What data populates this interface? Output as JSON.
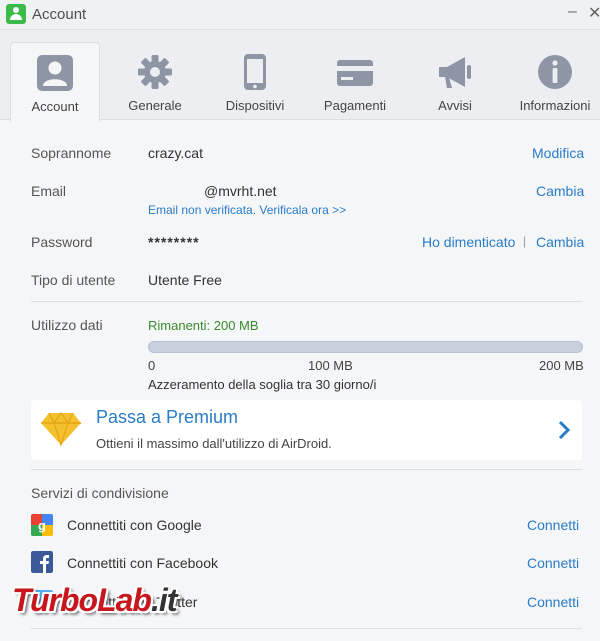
{
  "window": {
    "title": "Account"
  },
  "tabs": [
    {
      "label": "Account",
      "icon": "user-icon",
      "active": true
    },
    {
      "label": "Generale",
      "icon": "gear-icon"
    },
    {
      "label": "Dispositivi",
      "icon": "phone-icon"
    },
    {
      "label": "Pagamenti",
      "icon": "credit-card-icon"
    },
    {
      "label": "Avvisi",
      "icon": "megaphone-icon"
    },
    {
      "label": "Informazioni",
      "icon": "info-icon"
    }
  ],
  "account": {
    "nickname_label": "Soprannome",
    "nickname_value": "crazy.cat",
    "nickname_action": "Modifica",
    "email_label": "Email",
    "email_value": "@mvrht.net",
    "email_action": "Cambia",
    "email_warning": "Email non verificata. Verificala ora >>",
    "password_label": "Password",
    "password_value": "********",
    "password_forgot": "Ho dimenticato",
    "password_separator": "|",
    "password_action": "Cambia",
    "user_type_label": "Tipo di utente",
    "user_type_value": "Utente Free"
  },
  "data_usage": {
    "label": "Utilizzo dati",
    "remaining": "Rimanenti: 200 MB",
    "used_fraction": 0,
    "ticks": [
      "0",
      "100 MB",
      "200 MB"
    ],
    "reset_note": "Azzeramento della soglia tra 30 giorno/i"
  },
  "premium": {
    "title": "Passa a Premium",
    "subtitle": "Ottieni il massimo dall'utilizzo di AirDroid.",
    "icon": "diamond-icon"
  },
  "sharing": {
    "header": "Servizi di condivisione",
    "services": [
      {
        "label": "Connettiti con Google",
        "action": "Connetti",
        "icon": "google-icon"
      },
      {
        "label": "Connettiti con Facebook",
        "action": "Connetti",
        "icon": "facebook-icon"
      },
      {
        "label": "Connettiti con Twitter",
        "action": "Connetti",
        "icon": "twitter-icon"
      }
    ]
  },
  "watermark": {
    "text_red": "TurboLab",
    "text_dark": ".it"
  },
  "colors": {
    "accent": "#2a7cc7",
    "green": "#3a8a2e",
    "icon_gray": "#8e96a6",
    "premium_gold": "#f4c02e"
  }
}
